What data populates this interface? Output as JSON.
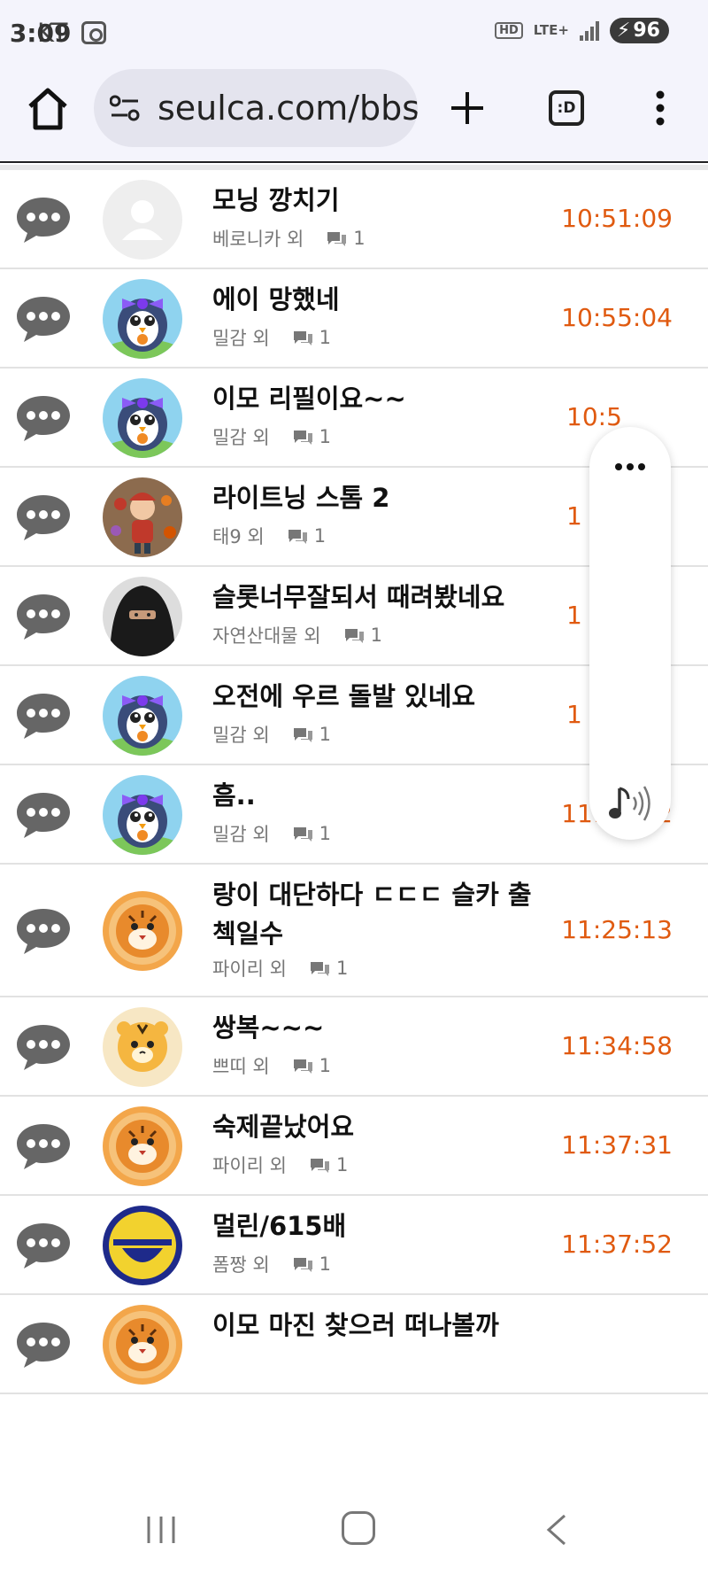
{
  "status_bar": {
    "carrier": "KT",
    "time": "3:09",
    "hd_badge": "HD",
    "network": "LTE+",
    "battery": "96"
  },
  "browser": {
    "url": "seulca.com/bbs",
    "tabs_label": ":D"
  },
  "list": {
    "rows": [
      {
        "title": "모닝 깡치기",
        "author": "베로니카 외",
        "comments": "1",
        "time": "10:51:09",
        "avatar": "default-avatar"
      },
      {
        "title": "에이 망했네",
        "author": "밀감 외",
        "comments": "1",
        "time": "10:55:04",
        "avatar": "penguin-avatar"
      },
      {
        "title": "이모 리필이요~~",
        "author": "밀감 외",
        "comments": "1",
        "time": "10:5",
        "avatar": "penguin-avatar"
      },
      {
        "title": "라이트닝 스톰 2",
        "author": "태9 외",
        "comments": "1",
        "time": "1",
        "avatar": "boy-avatar"
      },
      {
        "title": "슬롯너무잘되서 때려봤네요",
        "author": "자연산대물 외",
        "comments": "1",
        "time": "1",
        "avatar": "veiled-avatar"
      },
      {
        "title": "오전에 우르 돌발 있네요",
        "author": "밀감 외",
        "comments": "1",
        "time": "1",
        "avatar": "penguin-avatar"
      },
      {
        "title": "흠..",
        "author": "밀감 외",
        "comments": "1",
        "time": "11:20:42",
        "avatar": "penguin-avatar"
      },
      {
        "title": "랑이 대단하다 ㄷㄷㄷ 슬카 출첵일수",
        "author": "파이리 외",
        "comments": "1",
        "time": "11:25:13",
        "avatar": "tiger-avatar"
      },
      {
        "title": "쌍복~~~",
        "author": "쁘띠 외",
        "comments": "1",
        "time": "11:34:58",
        "avatar": "tiger-cub-avatar"
      },
      {
        "title": "숙제끝났어요",
        "author": "파이리 외",
        "comments": "1",
        "time": "11:37:31",
        "avatar": "tiger-avatar"
      },
      {
        "title": "멀린/615배",
        "author": "폼짱 외",
        "comments": "1",
        "time": "11:37:52",
        "avatar": "smile-avatar"
      },
      {
        "title": "이모 마진 찾으러 떠나볼까",
        "author": "",
        "comments": "",
        "time": "",
        "avatar": "tiger-avatar"
      }
    ]
  },
  "colors": {
    "time_accent": "#e05a10",
    "toolbar_bg": "#f4f4fc"
  },
  "icons": {
    "home": "home-icon",
    "site_info": "site-settings-icon",
    "new_tab": "plus-icon",
    "menu": "more-vert-icon",
    "chat": "chat-bubble-icon",
    "comment": "comment-icon",
    "speaker": "music-speaker-icon"
  }
}
